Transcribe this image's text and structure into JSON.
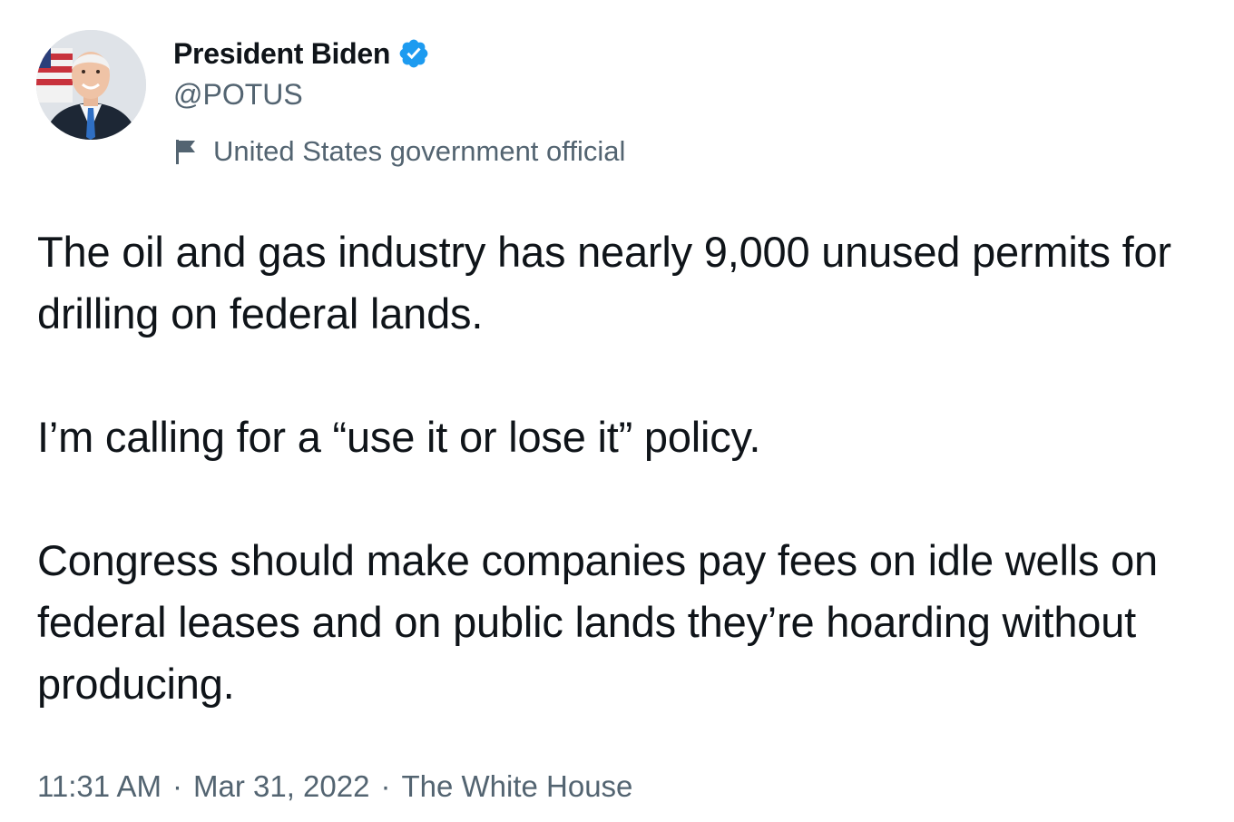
{
  "author": {
    "display_name": "President Biden",
    "handle": "@POTUS",
    "verified_icon": "verified-badge-icon",
    "avatar_icon": "portrait-avatar",
    "label_icon": "flag-icon",
    "label_text": "United States government official"
  },
  "tweet": {
    "paragraphs": [
      "The oil and gas industry has nearly 9,000 unused permits for drilling on federal lands.",
      "I’m calling for a “use it or lose it” policy.",
      "Congress should make companies pay fees on idle wells on federal leases and on public lands they’re hoarding without producing."
    ]
  },
  "meta": {
    "time": "11:31 AM",
    "separator": "·",
    "date": "Mar 31, 2022",
    "source": "The White House"
  },
  "colors": {
    "text_primary": "#0f1419",
    "text_secondary": "#536471",
    "verified_blue": "#1d9bf0",
    "background": "#ffffff"
  }
}
